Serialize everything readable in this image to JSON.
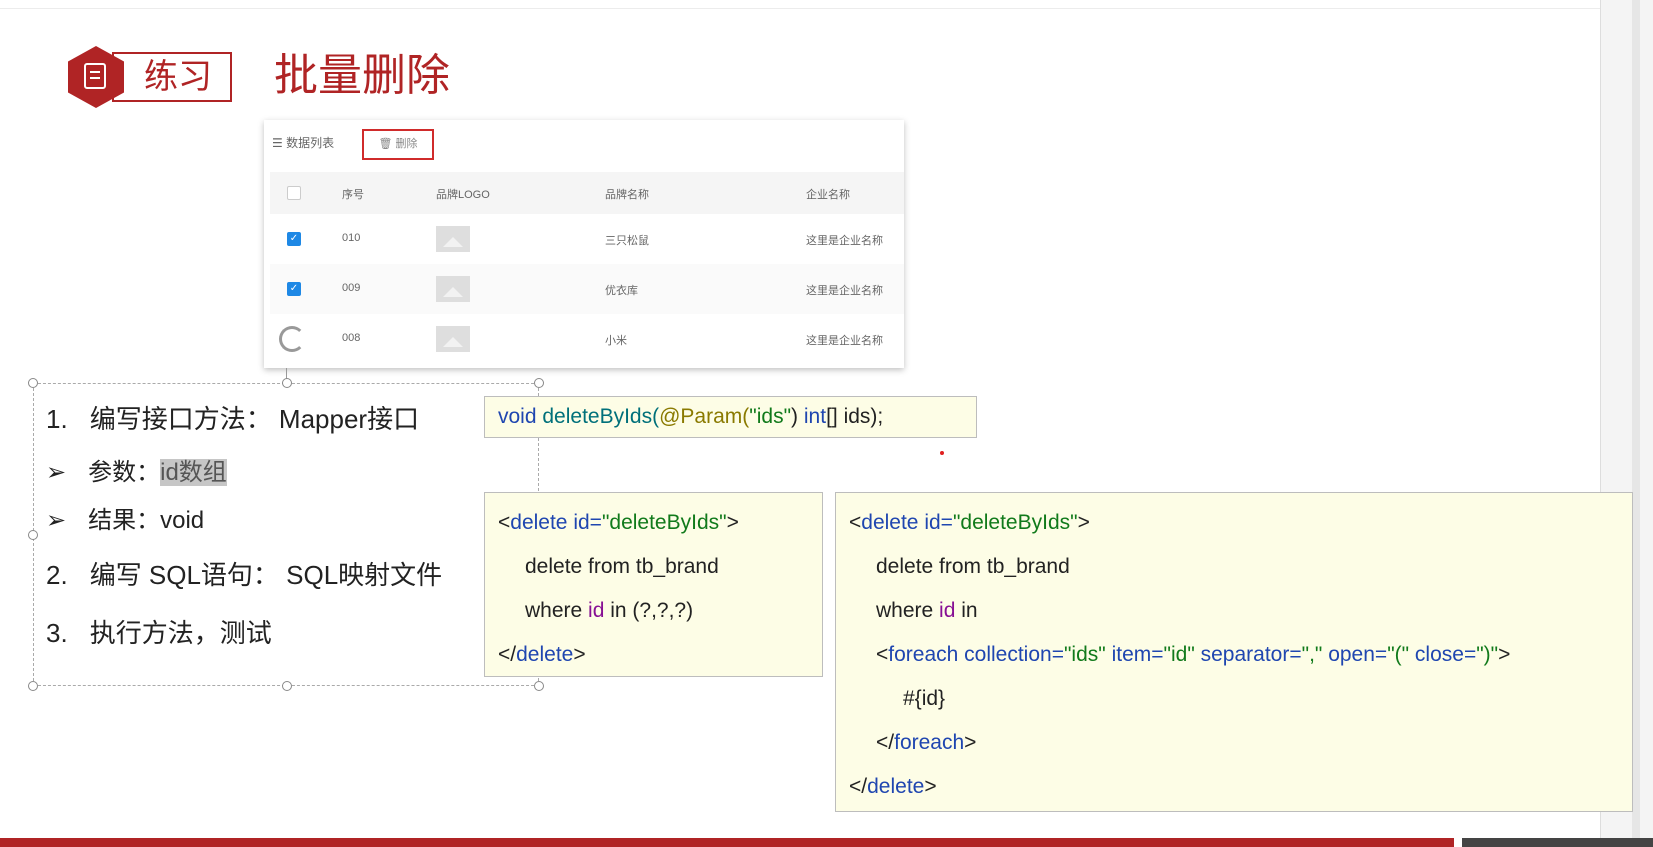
{
  "header": {
    "badge_label": "练习",
    "title": "批量删除"
  },
  "table": {
    "list_label": "数据列表",
    "delete_button": "删除",
    "columns": [
      "序号",
      "品牌LOGO",
      "品牌名称",
      "企业名称"
    ],
    "rows": [
      {
        "checked": true,
        "id": "010",
        "brand": "三只松鼠",
        "company": "这里是企业名称"
      },
      {
        "checked": true,
        "id": "009",
        "brand": "优衣库",
        "company": "这里是企业名称"
      },
      {
        "checked": false,
        "id": "008",
        "brand": "小米",
        "company": "这里是企业名称"
      }
    ]
  },
  "steps": {
    "s1_num": "1.",
    "s1_text": "编写接口方法：  Mapper接口",
    "b1_prefix": "参数：",
    "b1_highlight": "id数组",
    "b2_text": "结果：void",
    "s2_num": "2.",
    "s2_text": "编写 SQL语句：  SQL映射文件",
    "s3_num": "3.",
    "s3_text": "执行方法，测试"
  },
  "code_interface": {
    "kw_void": "void",
    "method": "deleteByIds(",
    "annotation": "@Param(",
    "str": "\"ids\"",
    "close_paren": ")",
    "kw_int": "int",
    "rest": "[] ids);"
  },
  "code_sql1": {
    "line1_a": "<",
    "line1_tag": "delete",
    "line1_attr": " id=",
    "line1_val": "\"deleteByIds\"",
    "line1_end": ">",
    "line2": "delete from tb_brand",
    "line3_a": "where ",
    "line3_id": "id",
    "line3_b": " in (?,?,?)",
    "line4_a": "</",
    "line4_tag": "delete",
    "line4_end": ">"
  },
  "code_sql2": {
    "line1_a": "<",
    "line1_tag": "delete",
    "line1_attr": " id=",
    "line1_val": "\"deleteByIds\"",
    "line1_end": ">",
    "line2": "delete from tb_brand",
    "line3_a": "where ",
    "line3_id": "id",
    "line3_b": " in",
    "line4_a": "<",
    "line4_tag": "foreach",
    "line4_attr1": " collection=",
    "line4_val1": "\"ids\"",
    "line4_attr2": " item=",
    "line4_val2": "\"id\"",
    "line4_attr3": " separator=",
    "line4_val3": "\",\"",
    "line4_attr4": " open=",
    "line4_val4": "\"(\"",
    "line4_attr5": " close=",
    "line4_val5": "\")\"",
    "line4_end": ">",
    "line5": "#{id}",
    "line6_a": "</",
    "line6_tag": "foreach",
    "line6_end": ">",
    "line7_a": "</",
    "line7_tag": "delete",
    "line7_end": ">"
  },
  "colors": {
    "brand_red": "#b02425",
    "code_bg": "#fdfde6",
    "keyword_blue": "#1f46b0",
    "string_green": "#117a1b"
  }
}
